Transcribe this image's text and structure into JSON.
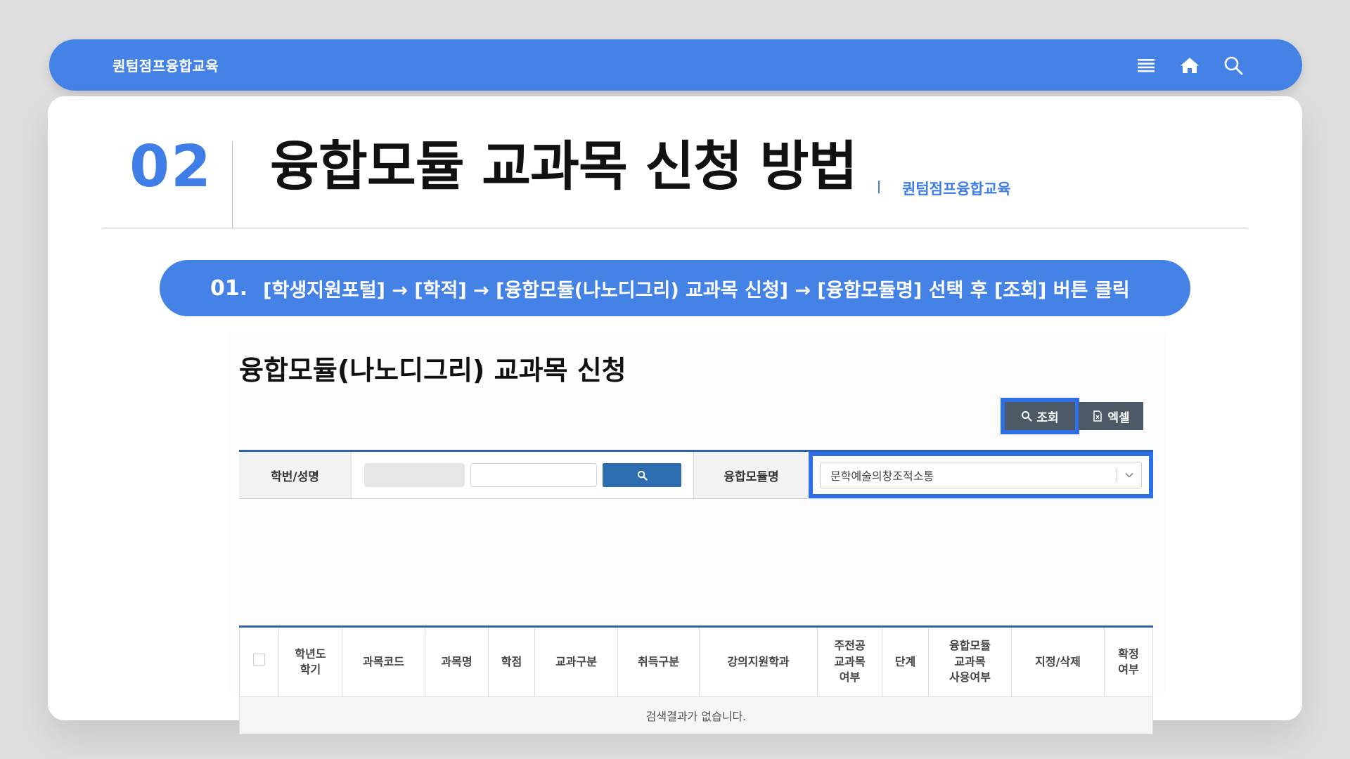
{
  "topbar": {
    "brand": "퀀텀점프융합교육",
    "icons": [
      "menu-icon",
      "home-icon",
      "search-icon"
    ]
  },
  "heading": {
    "number": "02",
    "title": "융합모듈 교과목 신청 방법",
    "brand": "퀀텀점프융합교육"
  },
  "step": {
    "number": "01.",
    "text": "[학생지원포털] → [학적] → [융합모듈(나노디그리) 교과목 신청] → [융합모듈명] 선택 후 [조회] 버튼 클릭"
  },
  "screen": {
    "title": "융합모듈(나노디그리) 교과목 신청",
    "buttons": {
      "query": "조회",
      "excel": "엑셀"
    },
    "search": {
      "student_label": "학번/성명",
      "module_label": "융합모듈명",
      "module_value": "문학예술의창조적소통"
    },
    "table": {
      "headers": [
        [
          "학년도",
          "학기"
        ],
        [
          "과목코드"
        ],
        [
          "과목명"
        ],
        [
          "학점"
        ],
        [
          "교과구분"
        ],
        [
          "취득구분"
        ],
        [
          "강의지원학과"
        ],
        [
          "주전공",
          "교과목",
          "여부"
        ],
        [
          "단계"
        ],
        [
          "융합모듈",
          "교과목",
          "사용여부"
        ],
        [
          "지정/삭제"
        ],
        [
          "확정",
          "여부"
        ]
      ],
      "empty_message": "검색결과가 없습니다."
    }
  },
  "colors": {
    "accent": "#4582e6",
    "heading_number": "#3f7ee6",
    "highlight": "#2f6fe6",
    "table_border": "#2e63a8"
  }
}
